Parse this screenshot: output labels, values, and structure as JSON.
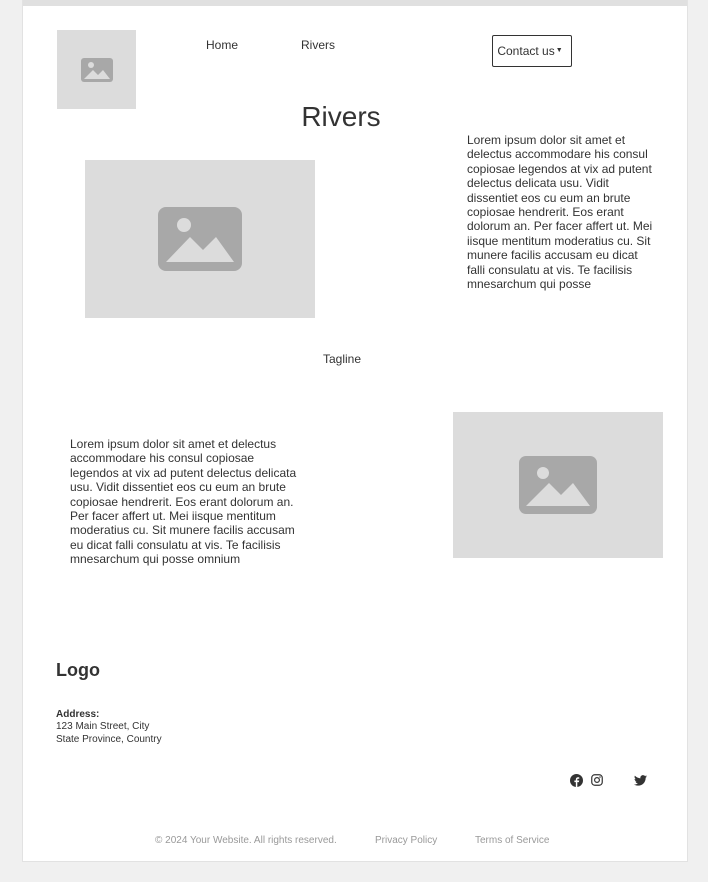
{
  "header": {
    "logo_image": "image-placeholder-icon",
    "nav": [
      {
        "label": "Home"
      },
      {
        "label": "Rivers"
      }
    ],
    "contact_label": "Contact us"
  },
  "main": {
    "title": "Rivers",
    "intro_text": "Lorem ipsum dolor sit amet et delectus accommodare his consul copiosae legendos at vix ad putent delectus delicata usu. Vidit dissentiet eos cu eum an brute copiosae hendrerit. Eos erant dolorum an. Per facer affert ut. Mei iisque mentitum moderatius cu. Sit munere facilis accusam eu dicat falli consulatu at vis. Te facilisis mnesarchum qui posse",
    "tagline": "Tagline",
    "body_text": "Lorem ipsum dolor sit amet et delectus accommodare his consul copiosae legendos at vix ad putent delectus delicata usu. Vidit dissentiet eos cu eum an brute copiosae hendrerit. Eos erant dolorum an. Per facer affert ut. Mei iisque mentitum moderatius cu. Sit munere facilis accusam eu dicat falli consulatu at vis. Te facilisis mnesarchum qui posse omnium"
  },
  "footer": {
    "logo_text": "Logo",
    "address_label": "Address:",
    "address_line1": "123 Main Street, City",
    "address_line2": "State Province, Country",
    "social_icons": [
      "facebook-icon",
      "instagram-icon",
      "twitter-icon"
    ],
    "copyright": "© 2024 Your Website. All rights reserved.",
    "privacy_label": "Privacy Policy",
    "terms_label": "Terms of Service"
  },
  "colors": {
    "placeholder_bg": "#dcdcdc",
    "placeholder_icon": "#a8a8a8",
    "text": "#333333",
    "muted_text": "#999999"
  }
}
